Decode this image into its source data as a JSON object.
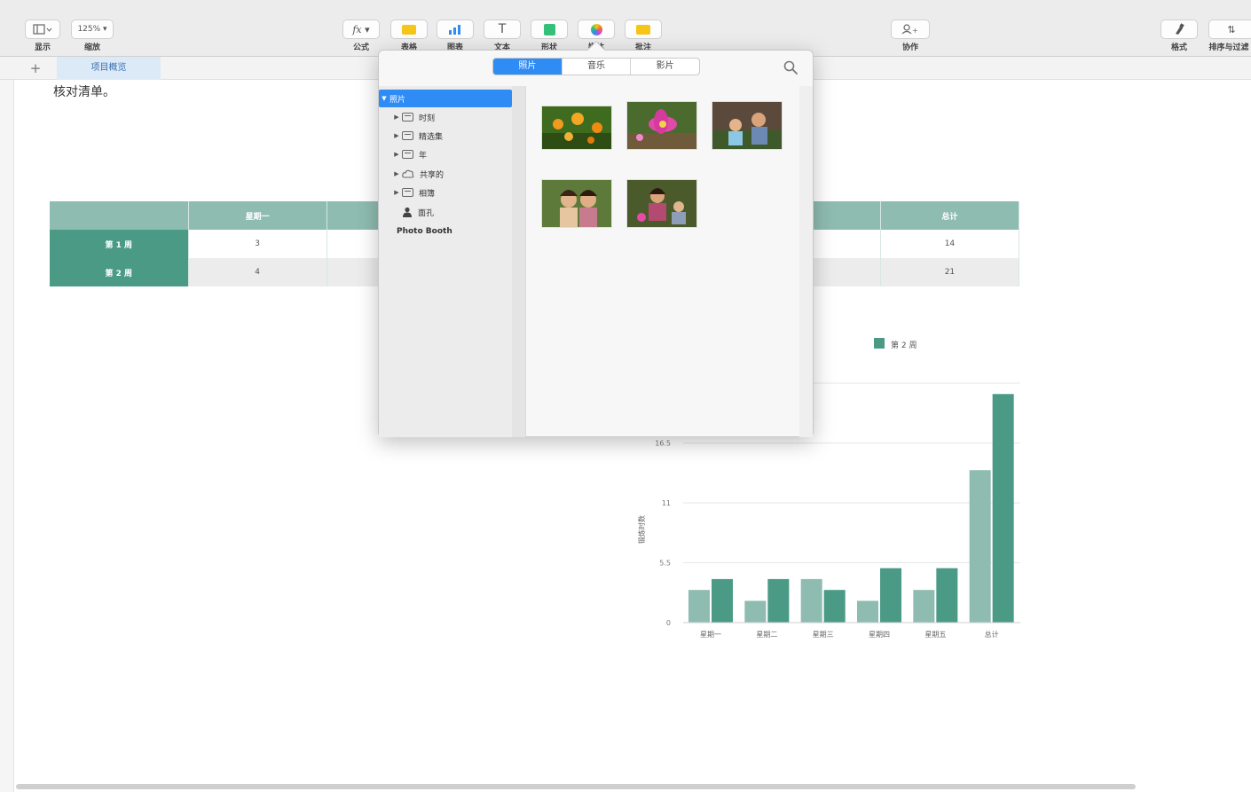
{
  "toolbar": {
    "view_label": "显示",
    "zoom_value": "125% ▾",
    "zoom_label": "缩放",
    "formula_label": "公式",
    "table_label": "表格",
    "chart_label": "图表",
    "text_label": "文本",
    "shape_label": "形状",
    "media_label": "媒体",
    "comment_label": "批注",
    "collaborate_label": "协作",
    "format_label": "格式",
    "sort_label": "排序与过滤"
  },
  "sheet": {
    "add_label": "+",
    "tab_label": "项目概览"
  },
  "document": {
    "heading": "核对清单。"
  },
  "table": {
    "headers": [
      "",
      "星期一",
      "",
      "",
      "",
      "",
      "总计"
    ],
    "rows": [
      {
        "label": "第 1 周",
        "cells": [
          "3",
          "",
          "",
          "",
          "",
          "14"
        ]
      },
      {
        "label": "第 2 周",
        "cells": [
          "4",
          "",
          "",
          "",
          "",
          "21"
        ]
      }
    ]
  },
  "chart_data": {
    "type": "bar",
    "categories": [
      "星期一",
      "星期二",
      "星期三",
      "星期四",
      "星期五",
      "总计"
    ],
    "series": [
      {
        "name": "第 1 周",
        "values": [
          3,
          2,
          4,
          2,
          3,
          14
        ]
      },
      {
        "name": "第 2 周",
        "values": [
          4,
          4,
          3,
          5,
          5,
          21
        ]
      }
    ],
    "ylabel": "锻炼时数",
    "yticks": [
      "0",
      "5.5",
      "11",
      "16.5"
    ],
    "ylim": [
      0,
      22
    ],
    "legend": [
      "第 2 周"
    ],
    "legend_position": "top-right",
    "colors": {
      "series1": "#8fbcb0",
      "series2": "#4a9a86"
    }
  },
  "media_popover": {
    "tabs": [
      "照片",
      "音乐",
      "影片"
    ],
    "active_tab": "照片",
    "sidebar": [
      {
        "label": "照片",
        "icon": "disclosure",
        "selected": true
      },
      {
        "label": "时刻",
        "icon": "folder-icon"
      },
      {
        "label": "精选集",
        "icon": "folder-icon"
      },
      {
        "label": "年",
        "icon": "folder-icon"
      },
      {
        "label": "共享的",
        "icon": "cloud-icon"
      },
      {
        "label": "相簿",
        "icon": "folder-icon"
      },
      {
        "label": "面孔",
        "icon": "person-icon"
      },
      {
        "label": "Photo Booth",
        "icon": "none"
      }
    ]
  },
  "colors": {
    "accent": "#2f8cf5",
    "table_header": "#8fbcb0",
    "table_row_header": "#4a9a86"
  }
}
